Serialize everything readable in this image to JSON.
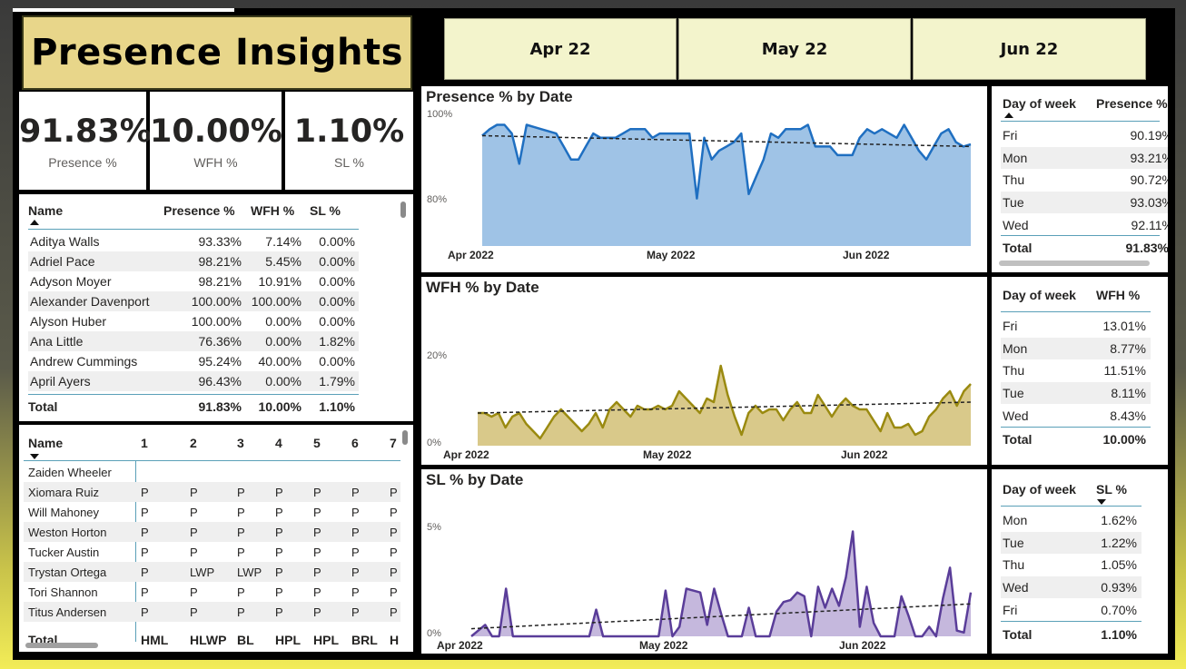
{
  "title": "Presence Insights",
  "kpis": [
    {
      "value": "91.83%",
      "label": "Presence %"
    },
    {
      "value": "10.00%",
      "label": "WFH %"
    },
    {
      "value": "1.10%",
      "label": "SL %"
    }
  ],
  "months": [
    "Apr 22",
    "May 22",
    "Jun 22"
  ],
  "employee_table": {
    "headers": [
      "Name",
      "Presence %",
      "WFH %",
      "SL %"
    ],
    "rows": [
      [
        "Aditya Walls",
        "93.33%",
        "7.14%",
        "0.00%"
      ],
      [
        "Adriel Pace",
        "98.21%",
        "5.45%",
        "0.00%"
      ],
      [
        "Adyson Moyer",
        "98.21%",
        "10.91%",
        "0.00%"
      ],
      [
        "Alexander Davenport",
        "100.00%",
        "100.00%",
        "0.00%"
      ],
      [
        "Alyson Huber",
        "100.00%",
        "0.00%",
        "0.00%"
      ],
      [
        "Ana Little",
        "76.36%",
        "0.00%",
        "1.82%"
      ],
      [
        "Andrew Cummings",
        "95.24%",
        "40.00%",
        "0.00%"
      ],
      [
        "April Ayers",
        "96.43%",
        "0.00%",
        "1.79%"
      ]
    ],
    "total": [
      "Total",
      "91.83%",
      "10.00%",
      "1.10%"
    ]
  },
  "matrix": {
    "headers": [
      "Name",
      "1",
      "2",
      "3",
      "4",
      "5",
      "6",
      "7"
    ],
    "rows": [
      [
        "Zaiden Wheeler",
        "",
        "",
        "",
        "",
        "",
        "",
        ""
      ],
      [
        "Xiomara Ruiz",
        "P",
        "P",
        "P",
        "P",
        "P",
        "P",
        "P"
      ],
      [
        "Will Mahoney",
        "P",
        "P",
        "P",
        "P",
        "P",
        "P",
        "P"
      ],
      [
        "Weston Horton",
        "P",
        "P",
        "P",
        "P",
        "P",
        "P",
        "P"
      ],
      [
        "Tucker Austin",
        "P",
        "P",
        "P",
        "P",
        "P",
        "P",
        "P"
      ],
      [
        "Trystan Ortega",
        "P",
        "LWP",
        "LWP",
        "P",
        "P",
        "P",
        "P"
      ],
      [
        "Tori Shannon",
        "P",
        "P",
        "P",
        "P",
        "P",
        "P",
        "P"
      ],
      [
        "Titus Andersen",
        "P",
        "P",
        "P",
        "P",
        "P",
        "P",
        "P"
      ]
    ],
    "total": [
      "Total",
      "HML",
      "HLWP",
      "BL",
      "HPL",
      "HPL",
      "BRL",
      "H"
    ]
  },
  "charts": {
    "presence": {
      "title": "Presence % by Date",
      "y_top": "100%",
      "y_mid": "80%",
      "x": [
        "Apr 2022",
        "May 2022",
        "Jun 2022"
      ]
    },
    "wfh": {
      "title": "WFH % by Date",
      "y_top": "20%",
      "y_bottom": "0%",
      "x": [
        "Apr 2022",
        "May 2022",
        "Jun 2022"
      ]
    },
    "sl": {
      "title": "SL % by Date",
      "y_top": "5%",
      "y_bottom": "0%",
      "x": [
        "Apr 2022",
        "May 2022",
        "Jun 2022"
      ]
    }
  },
  "dow_presence": {
    "headers": [
      "Day of week",
      "Presence %"
    ],
    "rows": [
      [
        "Fri",
        "90.19%"
      ],
      [
        "Mon",
        "93.21%"
      ],
      [
        "Thu",
        "90.72%"
      ],
      [
        "Tue",
        "93.03%"
      ],
      [
        "Wed",
        "92.11%"
      ]
    ],
    "total": [
      "Total",
      "91.83%"
    ]
  },
  "dow_wfh": {
    "headers": [
      "Day of week",
      "WFH %"
    ],
    "rows": [
      [
        "Fri",
        "13.01%"
      ],
      [
        "Mon",
        "8.77%"
      ],
      [
        "Thu",
        "11.51%"
      ],
      [
        "Tue",
        "8.11%"
      ],
      [
        "Wed",
        "8.43%"
      ]
    ],
    "total": [
      "Total",
      "10.00%"
    ]
  },
  "dow_sl": {
    "headers": [
      "Day of week",
      "SL %"
    ],
    "rows": [
      [
        "Mon",
        "1.62%"
      ],
      [
        "Tue",
        "1.22%"
      ],
      [
        "Thu",
        "1.05%"
      ],
      [
        "Wed",
        "0.93%"
      ],
      [
        "Fri",
        "0.70%"
      ]
    ],
    "total": [
      "Total",
      "1.10%"
    ]
  },
  "chart_data": [
    {
      "type": "area",
      "title": "Presence % by Date",
      "color": "#1f6fc1",
      "fill": "#9fc3e6",
      "ylim": [
        70,
        100
      ],
      "x_ticks": [
        "Apr 2022",
        "May 2022",
        "Jun 2022"
      ],
      "trendline": [
        95.5,
        93.0
      ],
      "values": [
        95.5,
        97,
        98,
        98,
        96,
        89,
        98,
        97.5,
        97,
        96.5,
        96,
        93,
        90,
        90,
        93,
        96,
        95,
        95,
        95,
        96,
        97,
        97,
        97,
        95,
        96,
        96,
        96,
        96,
        96,
        81,
        95,
        90,
        92,
        93,
        94,
        96,
        82,
        86,
        90,
        96,
        95,
        97,
        97,
        97,
        98,
        93,
        93,
        93,
        91,
        91,
        91,
        95,
        97,
        96,
        97,
        96,
        95,
        98,
        95,
        92,
        90,
        93,
        96,
        97,
        94,
        93,
        93.5
      ]
    },
    {
      "type": "area",
      "title": "WFH % by Date",
      "color": "#9a8a10",
      "fill": "#d9c98a",
      "ylim": [
        0,
        25
      ],
      "x_ticks": [
        "Apr 2022",
        "May 2022",
        "Jun 2022"
      ],
      "trendline": [
        9,
        12
      ],
      "values": [
        9,
        9,
        8,
        9,
        5,
        8,
        9,
        6,
        4,
        2,
        5,
        8,
        10,
        8,
        6,
        4,
        6,
        9,
        5,
        10,
        12,
        10,
        8,
        11,
        10,
        10,
        11,
        10,
        11,
        15,
        13,
        11,
        9,
        13,
        12,
        22,
        14,
        8,
        3,
        9,
        11,
        9,
        10,
        10,
        7,
        10,
        12,
        9,
        9,
        14,
        11,
        8,
        11,
        13,
        11,
        10,
        10,
        7,
        4,
        9,
        5,
        5,
        6,
        3,
        4,
        8,
        10,
        13,
        15,
        11,
        15,
        17
      ]
    },
    {
      "type": "area",
      "title": "SL % by Date",
      "color": "#5a3d99",
      "fill": "#c5b8dd",
      "ylim": [
        0,
        6
      ],
      "x_ticks": [
        "Apr 2022",
        "May 2022",
        "Jun 2022"
      ],
      "trendline": [
        0.4,
        1.7
      ],
      "values": [
        0,
        0.3,
        0.6,
        0,
        0,
        2.5,
        0,
        0,
        0,
        0,
        0,
        0,
        0,
        0,
        0,
        0,
        0,
        0,
        1.4,
        0,
        0,
        0,
        0,
        0,
        0,
        0,
        0,
        0,
        2.4,
        0,
        0.5,
        2.5,
        2.4,
        2.3,
        0.6,
        2.5,
        1.2,
        0,
        0,
        0,
        1.5,
        0,
        0,
        0,
        1.3,
        1.8,
        1.9,
        2.3,
        2.1,
        0,
        2.6,
        1.5,
        2.5,
        1.6,
        3.1,
        5.5,
        0.5,
        2.6,
        0.7,
        0,
        0,
        0,
        2.1,
        1.1,
        0,
        0,
        0.5,
        0,
        2,
        3.6,
        0.3,
        0.2,
        2.3
      ]
    }
  ]
}
